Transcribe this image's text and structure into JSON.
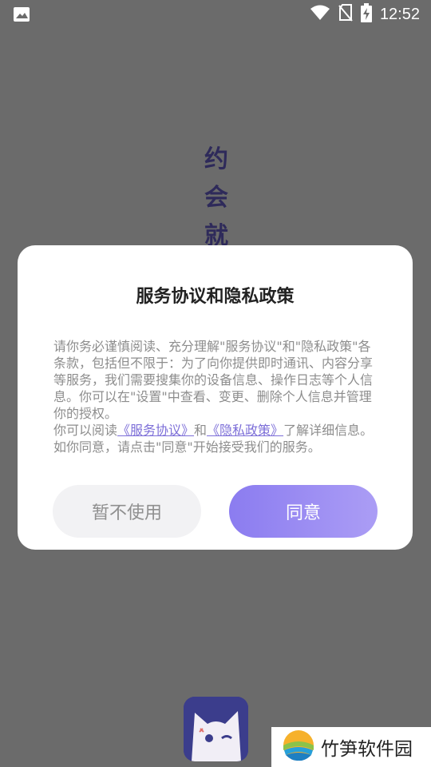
{
  "status_bar": {
    "left_icon": "image-icon",
    "icons": [
      "wifi-icon",
      "no-sim-icon",
      "battery-charging-icon"
    ],
    "time": "12:52"
  },
  "background": {
    "slogan_chars": [
      "约",
      "会",
      "就"
    ],
    "slogan_color": "#2e2a5a"
  },
  "dialog": {
    "title": "服务协议和隐私政策",
    "body": {
      "para1": "请你务必谨慎阅读、充分理解\"服务协议\"和\"隐私政策\"各条款，包括但不限于：为了向你提供即时通讯、内容分享等服务，我们需要搜集你的设备信息、操作日志等个人信息。你可以在\"设置\"中查看、变更、删除个人信息并管理你的授权。",
      "para2_prefix": "你可以阅读",
      "service_link": "《服务协议》",
      "and": "和",
      "privacy_link": "《隐私政策》",
      "para2_suffix": "了解详细信息。如你同意，请点击\"同意\"开始接受我们的服务。"
    },
    "decline_label": "暂不使用",
    "agree_label": "同意",
    "accent_color": "#8b7cf0"
  },
  "watermark": {
    "text": "竹笋软件园"
  }
}
